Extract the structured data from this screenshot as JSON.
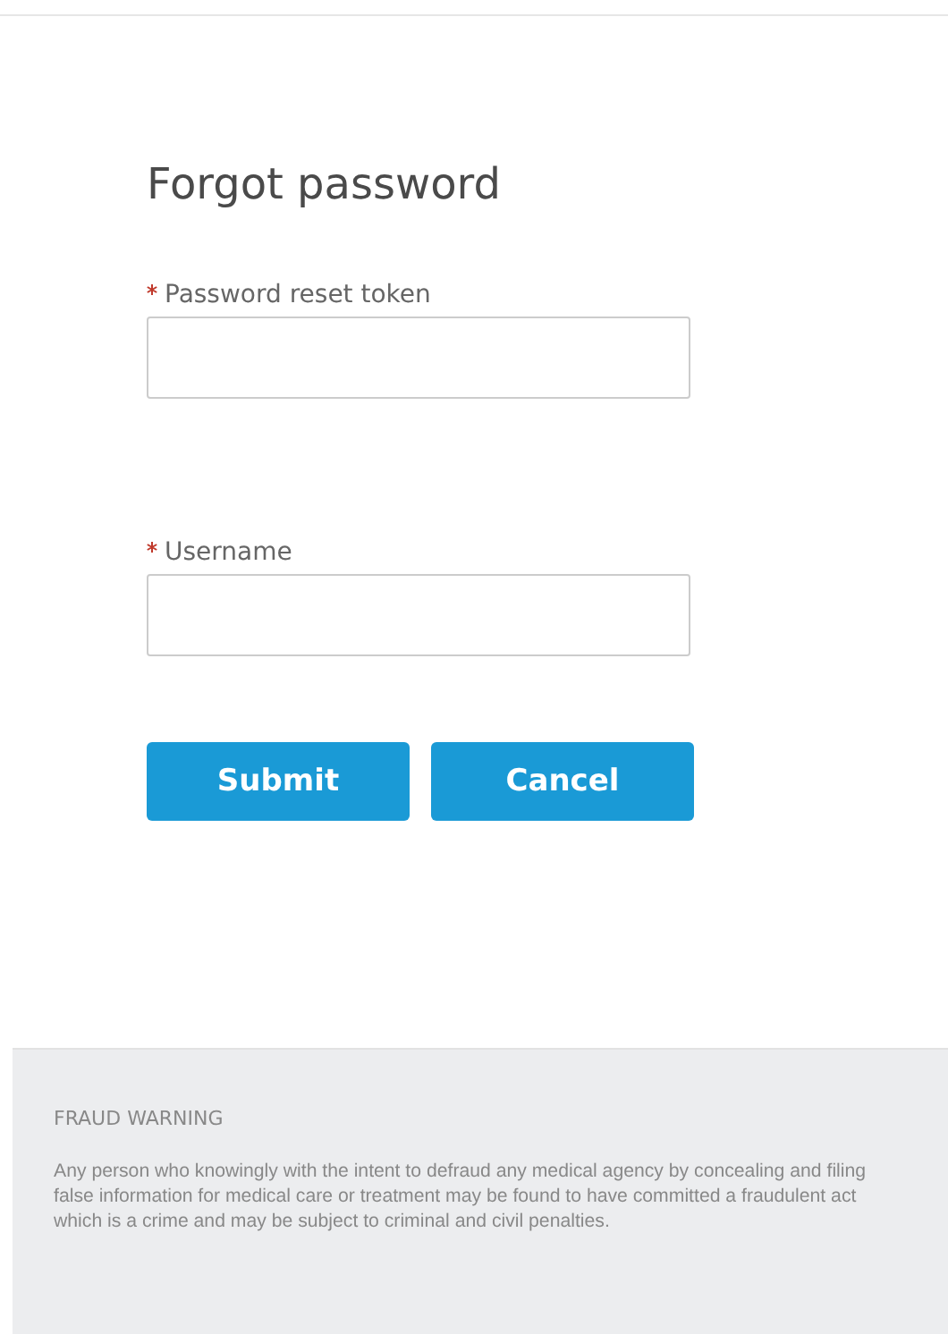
{
  "title": "Forgot password",
  "fields": [
    {
      "label": "Password reset token",
      "required": true
    },
    {
      "label": "Username",
      "required": true
    }
  ],
  "buttons": [
    "Submit",
    "Cancel"
  ],
  "footer": {
    "heading": "FRAUD WARNING",
    "text": "Any person who knowingly with the intent to defraud any medical agency by concealing and filing false information for medical care or treatment may be found to have committed a fraudulent act which is a crime and may be subject to criminal and civil penalties."
  }
}
